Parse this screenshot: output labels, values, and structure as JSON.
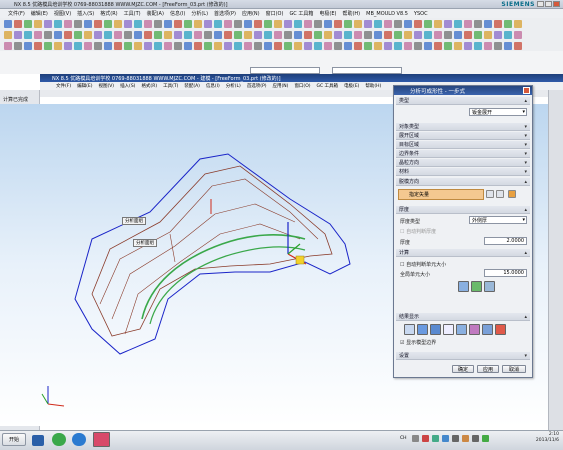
{
  "window": {
    "title": "NX 8.5  优路模具培训学校   0769-88031888  WWW.MJZC.COM - [FreeForm_03.prt (修改的)]",
    "brand": "SIEMENS"
  },
  "menu": [
    "文件(F)",
    "编辑(E)",
    "视图(V)",
    "插入(S)",
    "格式(R)",
    "工具(T)",
    "装配(A)",
    "信息(I)",
    "分析(L)",
    "首选项(P)",
    "应用(N)",
    "窗口(O)",
    "GC 工具箱",
    "电极(E)",
    "帮助(H)",
    "MB_MOULD V8.5",
    "YSOC"
  ],
  "inner_window": {
    "title": "NX 8.5  优路模具培训学校   0769-88031888  WWW.MJZC.COM - 建模 - [FreeForm_03.prt (修改的)]",
    "menu": [
      "文件(F)",
      "编辑(E)",
      "视图(V)",
      "插入(S)",
      "格式(R)",
      "工具(T)",
      "装配(A)",
      "信息(I)",
      "分析(L)",
      "首选项(P)",
      "应用(N)",
      "窗口(O)",
      "GC 工具箱",
      "电极(E)",
      "帮助(H)"
    ]
  },
  "viewport": {
    "label": "计算已完成",
    "tags": [
      "分析面组",
      "分析面组"
    ]
  },
  "dialog": {
    "title": "分析可成形性 - 一步式",
    "sections": {
      "type": "类型",
      "type_value": "钣金展开",
      "object_type": "对象类型",
      "unfold_region": "展开区域",
      "target_region": "目标区域",
      "boundary": "边界条件",
      "material_side": "晶粒方向",
      "material": "材料",
      "direction": "脱模方向",
      "direction_value": "指定矢量",
      "thickness": "厚度",
      "thickness_type_label": "厚度类型",
      "thickness_type_value": "外侧厚",
      "auto_thickness": "自动判断厚度",
      "thickness_label": "厚度",
      "thickness_value": "2.0000",
      "mesh": "计算",
      "auto_mesh": "自动判断单元大小",
      "global_element": "全局单元大小",
      "global_value": "15.0000",
      "results": "结果显示",
      "show_boundary": "显示模型边界",
      "settings": "设置"
    },
    "buttons": {
      "ok": "确定",
      "apply": "应用",
      "cancel": "取消"
    }
  },
  "taskbar": {
    "start": "开始",
    "time": "2:10",
    "date": "2013/11/6",
    "lang": "CH"
  },
  "colors": {
    "accent": "#2f5aa8",
    "model_blue": "#1a24c8",
    "model_brown": "#8a3b2a",
    "model_green": "#3aa84a"
  }
}
